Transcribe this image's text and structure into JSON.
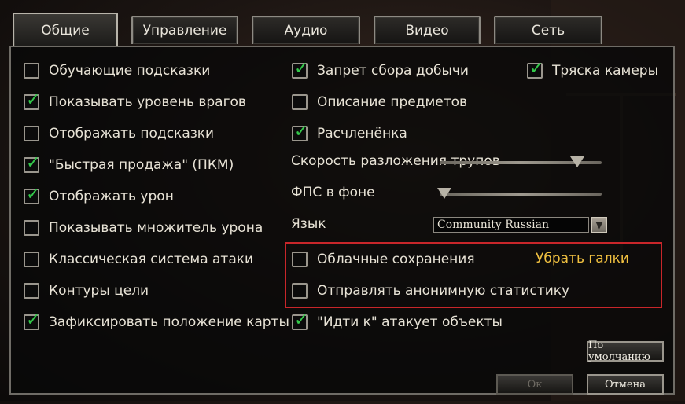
{
  "tabs": [
    {
      "label": "Общие",
      "active": true
    },
    {
      "label": "Управление",
      "active": false
    },
    {
      "label": "Аудио",
      "active": false
    },
    {
      "label": "Видео",
      "active": false
    },
    {
      "label": "Сеть",
      "active": false
    }
  ],
  "options_left": [
    {
      "label": "Обучающие подсказки",
      "checked": false
    },
    {
      "label": "Показывать уровень врагов",
      "checked": true
    },
    {
      "label": "Отображать подсказки",
      "checked": false
    },
    {
      "label": "\"Быстрая продажа\" (ПКМ)",
      "checked": true
    },
    {
      "label": "Отображать урон",
      "checked": true
    },
    {
      "label": "Показывать множитель урона",
      "checked": false
    },
    {
      "label": "Классическая система атаки",
      "checked": false
    },
    {
      "label": "Контуры цели",
      "checked": false
    },
    {
      "label": "Зафиксировать положение карты",
      "checked": true
    }
  ],
  "options_mid": [
    {
      "label": "Запрет сбора добычи",
      "checked": true
    },
    {
      "label": "Описание предметов",
      "checked": false
    },
    {
      "label": "Расчленёнка",
      "checked": true
    }
  ],
  "option_camera": {
    "label": "Тряска камеры",
    "checked": true
  },
  "sliders": [
    {
      "label": "Скорость разложения трупов",
      "value": 0.85
    },
    {
      "label": "ФПС в фоне",
      "value": 0.03
    }
  ],
  "language": {
    "label": "Язык",
    "selected": "Community Russian"
  },
  "options_boxed": [
    {
      "label": "Облачные сохранения",
      "checked": false
    },
    {
      "label": "Отправлять анонимную статистику",
      "checked": false
    }
  ],
  "option_goto": {
    "label": "\"Идти к\" атакует объекты",
    "checked": true
  },
  "annotation": "Убрать галки",
  "buttons": {
    "default": "По умолчанию",
    "ok": "Ок",
    "cancel": "Отмена"
  },
  "colors": {
    "check": "#33c94a",
    "annotation": "#f0c040",
    "highlight_box": "#c8262a"
  }
}
